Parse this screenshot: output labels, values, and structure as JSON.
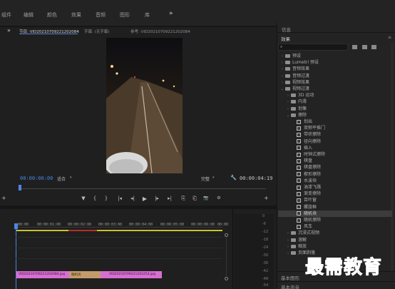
{
  "workspaces": [
    "组件",
    "编辑",
    "颜色",
    "效果",
    "音频",
    "图形",
    "库"
  ],
  "overflow_label": "»",
  "program": {
    "tabs": [
      "节目: VID20210709221202084",
      "字幕: (无字幕)",
      "参考: VID20210709221202084"
    ],
    "timecode_current": "00:00:00:00",
    "fit_label": "适合",
    "quality_label": "完整",
    "timecode_duration": "00:00:04:19",
    "controls": [
      "▼",
      "{",
      "}",
      "|◂",
      "◂|",
      "▶",
      "|▸",
      "▸|",
      "⎘",
      "⎗",
      "📷",
      "⚙"
    ]
  },
  "timeline": {
    "timecodes": [
      ":00:00",
      "00:00:01:00",
      "00:00:02:00",
      "00:00:03:00",
      "00:00:04:00",
      "00:00:05:00",
      "00:00:06:00",
      "00:00"
    ],
    "clip1_label": "VID20210709221202084.jpg",
    "transition_label": "随机块",
    "clip2_label": "VID20210709221202253.jpg"
  },
  "audio_meter": [
    "0",
    "-6",
    "-12",
    "-18",
    "-24",
    "-30",
    "-36",
    "-42",
    "-48",
    "-54"
  ],
  "effects_panel": {
    "info_tab": "信息",
    "title": "效果",
    "tree": [
      {
        "arrow": "›",
        "indent": 0,
        "icon": "bin",
        "label": "预设"
      },
      {
        "arrow": "›",
        "indent": 0,
        "icon": "bin",
        "label": "Lumetri 预设"
      },
      {
        "arrow": "›",
        "indent": 0,
        "icon": "bin",
        "label": "音频效果"
      },
      {
        "arrow": "›",
        "indent": 0,
        "icon": "bin",
        "label": "音频过渡"
      },
      {
        "arrow": "›",
        "indent": 0,
        "icon": "bin",
        "label": "视频效果"
      },
      {
        "arrow": "⌄",
        "indent": 0,
        "icon": "bin",
        "label": "视频过渡"
      },
      {
        "arrow": "›",
        "indent": 1,
        "icon": "bin",
        "label": "3D 运动"
      },
      {
        "arrow": "›",
        "indent": 1,
        "icon": "bin",
        "label": "内滑"
      },
      {
        "arrow": "›",
        "indent": 1,
        "icon": "bin",
        "label": "划像"
      },
      {
        "arrow": "⌄",
        "indent": 1,
        "icon": "bin",
        "label": "擦除"
      },
      {
        "arrow": "",
        "indent": 2,
        "icon": "fx",
        "label": "划出"
      },
      {
        "arrow": "",
        "indent": 2,
        "icon": "fx",
        "label": "双侧平推门"
      },
      {
        "arrow": "",
        "indent": 2,
        "icon": "fx",
        "label": "带状擦除"
      },
      {
        "arrow": "",
        "indent": 2,
        "icon": "fx",
        "label": "径向擦除"
      },
      {
        "arrow": "",
        "indent": 2,
        "icon": "fx",
        "label": "插入"
      },
      {
        "arrow": "",
        "indent": 2,
        "icon": "fx",
        "label": "时钟式擦除"
      },
      {
        "arrow": "",
        "indent": 2,
        "icon": "fx",
        "label": "棋盘"
      },
      {
        "arrow": "",
        "indent": 2,
        "icon": "fx",
        "label": "棋盘擦除"
      },
      {
        "arrow": "",
        "indent": 2,
        "icon": "fx",
        "label": "楔形擦除"
      },
      {
        "arrow": "",
        "indent": 2,
        "icon": "fx",
        "label": "水波块"
      },
      {
        "arrow": "",
        "indent": 2,
        "icon": "fx",
        "label": "油漆飞溅"
      },
      {
        "arrow": "",
        "indent": 2,
        "icon": "fx",
        "label": "渐变擦除"
      },
      {
        "arrow": "",
        "indent": 2,
        "icon": "fx",
        "label": "百叶窗"
      },
      {
        "arrow": "",
        "indent": 2,
        "icon": "fx",
        "label": "螺旋框"
      },
      {
        "arrow": "",
        "indent": 2,
        "icon": "fx",
        "label": "随机块",
        "selected": true
      },
      {
        "arrow": "",
        "indent": 2,
        "icon": "fx",
        "label": "随机擦除"
      },
      {
        "arrow": "",
        "indent": 2,
        "icon": "fx",
        "label": "风车"
      },
      {
        "arrow": "›",
        "indent": 1,
        "icon": "bin",
        "label": "沉浸式视频"
      },
      {
        "arrow": "›",
        "indent": 1,
        "icon": "bin",
        "label": "溶解"
      },
      {
        "arrow": "›",
        "indent": 1,
        "icon": "bin",
        "label": "缩放"
      },
      {
        "arrow": "›",
        "indent": 1,
        "icon": "bin",
        "label": "页面剥落"
      }
    ],
    "bottom_tabs": [
      "基本图形",
      "基本声音"
    ]
  },
  "watermark": "最需教育"
}
